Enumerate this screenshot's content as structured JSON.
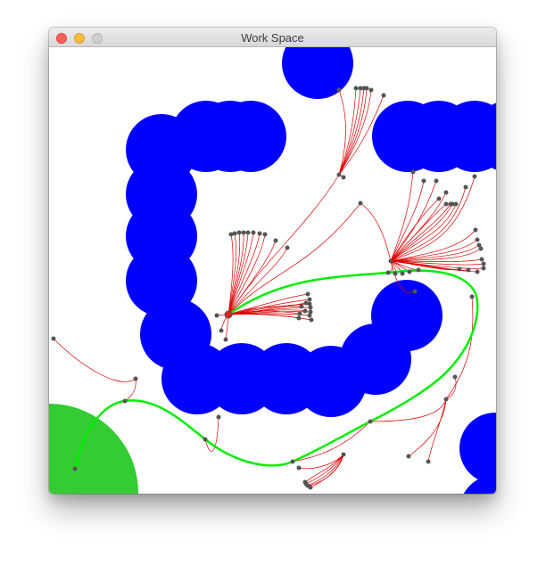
{
  "window": {
    "title": "Work Space"
  },
  "colors": {
    "obstacle": "#0000ff",
    "goal": "#33cc33",
    "tree_edge": "#dd0000",
    "path": "#00ee00",
    "node": "#555555",
    "start": "#e02020"
  }
}
